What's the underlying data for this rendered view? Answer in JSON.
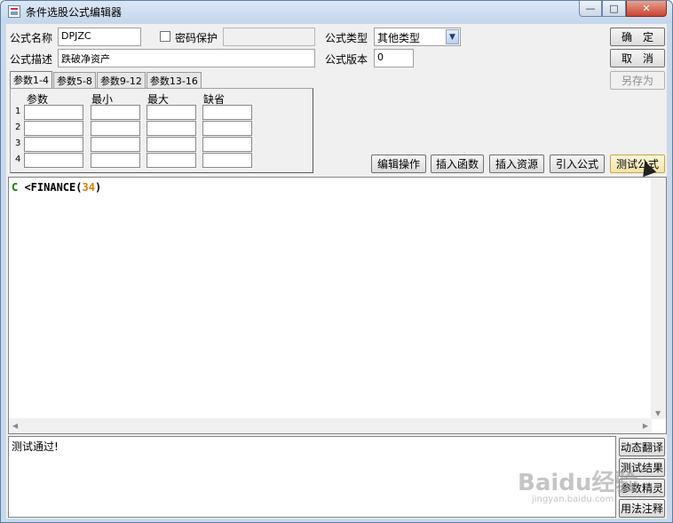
{
  "window": {
    "title": "条件选股公式编辑器",
    "controls": {
      "minimize": "—",
      "maximize": "□",
      "close": "✕"
    }
  },
  "form": {
    "name_label": "公式名称",
    "name_value": "DPJZC",
    "password_label": "密码保护",
    "password_checked": false,
    "desc_label": "公式描述",
    "desc_value": "跌破净资产",
    "type_label": "公式类型",
    "type_value": "其他类型",
    "version_label": "公式版本",
    "version_value": "0"
  },
  "buttons": {
    "ok": "确　定",
    "cancel": "取　消",
    "save_as": "另存为",
    "edit_ops": "编辑操作",
    "insert_func": "插入函数",
    "insert_resource": "插入资源",
    "import_formula": "引入公式",
    "test_formula": "测试公式"
  },
  "param_tabs": [
    "参数1-4",
    "参数5-8",
    "参数9-12",
    "参数13-16"
  ],
  "param_table": {
    "columns": [
      "参数",
      "最小",
      "最大",
      "缺省"
    ],
    "rows": [
      "1",
      "2",
      "3",
      "4"
    ]
  },
  "editor": {
    "code_prefix": "C",
    "code_mid": " <FINANCE(",
    "code_num": "34",
    "code_suffix": ")"
  },
  "result": {
    "text": "测试通过!"
  },
  "side_buttons": [
    "动态翻译",
    "测试结果",
    "参数精灵",
    "用法注释"
  ],
  "watermark": {
    "main": "Baidu经验",
    "sub": "jingyan.baidu.com"
  },
  "icons": [
    "app-icon",
    "checkbox-icon",
    "dropdown-arrow-icon",
    "scroll-arrow-icon",
    "cursor-icon"
  ]
}
